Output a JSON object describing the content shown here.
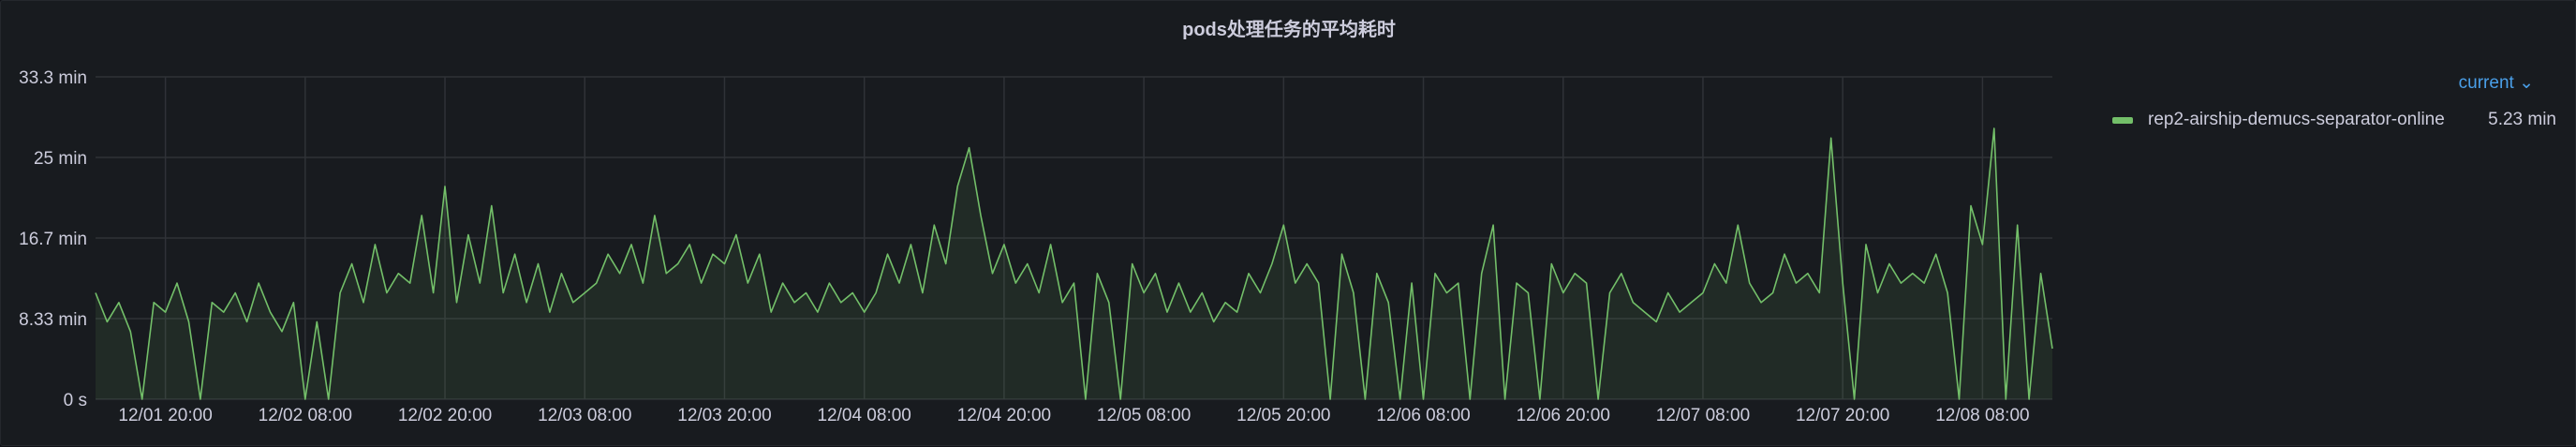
{
  "panel": {
    "title": "pods处理任务的平均耗时"
  },
  "legend": {
    "column": "current",
    "chevron_icon": "chevron-down-icon",
    "items": [
      {
        "name": "rep2-airship-demucs-separator-online",
        "value": "5.23 min",
        "color": "#73bf69"
      }
    ]
  },
  "chart_data": {
    "type": "area",
    "title": "pods处理任务的平均耗时",
    "xlabel": "",
    "ylabel": "",
    "unit": "min",
    "ylim": [
      0,
      33.33
    ],
    "yticks": [
      {
        "v": 0,
        "label": "0 s"
      },
      {
        "v": 8.33,
        "label": "8.33 min"
      },
      {
        "v": 16.67,
        "label": "16.7 min"
      },
      {
        "v": 25,
        "label": "25 min"
      },
      {
        "v": 33.33,
        "label": "33.3 min"
      }
    ],
    "x_start": "12/01 14:00",
    "x_step_hours": 1,
    "xlim_hours": [
      0,
      168
    ],
    "xticks": [
      {
        "h": 6,
        "label": "12/01 20:00"
      },
      {
        "h": 18,
        "label": "12/02 08:00"
      },
      {
        "h": 30,
        "label": "12/02 20:00"
      },
      {
        "h": 42,
        "label": "12/03 08:00"
      },
      {
        "h": 54,
        "label": "12/03 20:00"
      },
      {
        "h": 66,
        "label": "12/04 08:00"
      },
      {
        "h": 78,
        "label": "12/04 20:00"
      },
      {
        "h": 90,
        "label": "12/05 08:00"
      },
      {
        "h": 102,
        "label": "12/05 20:00"
      },
      {
        "h": 114,
        "label": "12/06 08:00"
      },
      {
        "h": 126,
        "label": "12/06 20:00"
      },
      {
        "h": 138,
        "label": "12/07 08:00"
      },
      {
        "h": 150,
        "label": "12/07 20:00"
      },
      {
        "h": 162,
        "label": "12/08 08:00"
      }
    ],
    "grid": true,
    "legend_placement": "right",
    "series": [
      {
        "name": "rep2-airship-demucs-separator-online",
        "color": "#73bf69",
        "values": [
          11,
          8,
          10,
          7,
          0,
          10,
          9,
          12,
          8,
          0,
          10,
          9,
          11,
          8,
          12,
          9,
          7,
          10,
          0,
          8,
          0,
          11,
          14,
          10,
          16,
          11,
          13,
          12,
          19,
          11,
          22,
          10,
          17,
          12,
          20,
          11,
          15,
          10,
          14,
          9,
          13,
          10,
          11,
          12,
          15,
          13,
          16,
          12,
          19,
          13,
          14,
          16,
          12,
          15,
          14,
          17,
          12,
          15,
          9,
          12,
          10,
          11,
          9,
          12,
          10,
          11,
          9,
          11,
          15,
          12,
          16,
          11,
          18,
          14,
          22,
          26,
          19,
          13,
          16,
          12,
          14,
          11,
          16,
          10,
          12,
          0,
          13,
          10,
          0,
          14,
          11,
          13,
          9,
          12,
          9,
          11,
          8,
          10,
          9,
          13,
          11,
          14,
          18,
          12,
          14,
          12,
          0,
          15,
          11,
          0,
          13,
          10,
          0,
          12,
          0,
          13,
          11,
          12,
          0,
          13,
          18,
          0,
          12,
          11,
          0,
          14,
          11,
          13,
          12,
          0,
          11,
          13,
          10,
          9,
          8,
          11,
          9,
          10,
          11,
          14,
          12,
          18,
          12,
          10,
          11,
          15,
          12,
          13,
          11,
          27,
          12,
          0,
          16,
          11,
          14,
          12,
          13,
          12,
          15,
          11,
          0,
          20,
          16,
          28,
          0,
          18,
          0,
          13,
          5.23
        ]
      }
    ]
  }
}
